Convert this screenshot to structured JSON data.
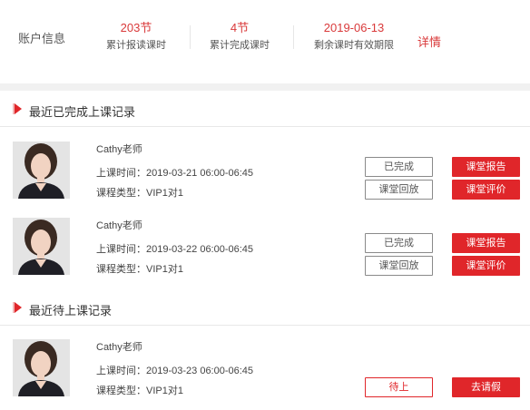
{
  "account": {
    "title": "账户信息",
    "stats": [
      {
        "value": "203节",
        "label": "累计报读课时"
      },
      {
        "value": "4节",
        "label": "累计完成课时"
      },
      {
        "value": "2019-06-13",
        "label": "剩余课时有效期限"
      }
    ],
    "detail_link": "详情"
  },
  "completed": {
    "heading": "最近已完成上课记录",
    "records": [
      {
        "teacher": "Cathy老师",
        "time": "上课时间：2019-03-21 06:00-06:45",
        "type": "课程类型：VIP1对1",
        "status_label": "已完成",
        "playback_label": "课堂回放",
        "report_label": "课堂报告",
        "evaluate_label": "课堂评价"
      },
      {
        "teacher": "Cathy老师",
        "time": "上课时间：2019-03-22 06:00-06:45",
        "type": "课程类型：VIP1对1",
        "status_label": "已完成",
        "playback_label": "课堂回放",
        "report_label": "课堂报告",
        "evaluate_label": "课堂评价"
      }
    ]
  },
  "upcoming": {
    "heading": "最近待上课记录",
    "records": [
      {
        "teacher": "Cathy老师",
        "time": "上课时间：2019-03-23 06:00-06:45",
        "type": "课程类型：VIP1对1",
        "status_label": "待上",
        "leave_label": "去请假"
      }
    ]
  },
  "colors": {
    "accent": "#e0262a",
    "accent_text": "#d9393a"
  },
  "icons": {
    "section_marker": "red-arrow-icon"
  }
}
